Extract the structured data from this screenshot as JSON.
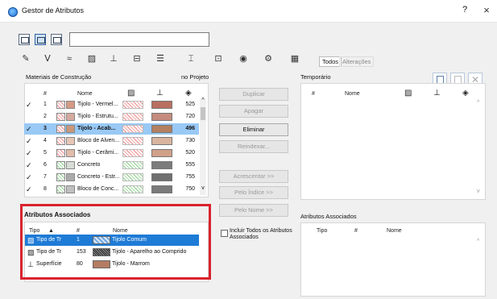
{
  "window": {
    "title": "Gestor de Atributos",
    "help": "?",
    "close": "×"
  },
  "toolbar": {
    "search_value": "",
    "attr_icons": [
      "pen-icon",
      "layer-icon",
      "line-type-icon",
      "fill-icon",
      "composite-icon",
      "profile-icon",
      "material-icon",
      "zone-icon",
      "markup-icon",
      "surface-icon",
      "mep-icon",
      "category-icon"
    ],
    "tab_all": "Todos",
    "tab_changes": "Alterações"
  },
  "left_panel": {
    "title": "Materiais de Construção",
    "project_label": "no Projeto",
    "headers": {
      "num": "#",
      "name": "Nome"
    },
    "rows": [
      {
        "check": "✓",
        "num": "1",
        "name": "Tijolo - Vermel...",
        "count": "525",
        "color": "#b97060",
        "swatch": "#d69a86",
        "hatch": "red"
      },
      {
        "check": "",
        "num": "2",
        "name": "Tijolo - Estrutu...",
        "count": "720",
        "color": "#c48b7e",
        "swatch": "#d5aaa0",
        "hatch": "red"
      },
      {
        "check": "✓",
        "num": "3",
        "name": "Tijolo - Acab...",
        "count": "496",
        "color": "#b38060",
        "swatch": "#c9987c",
        "hatch": "red",
        "selected": true
      },
      {
        "check": "✓",
        "num": "4",
        "name": "Bloco de Alven...",
        "count": "730",
        "color": "#d9b49e",
        "swatch": "#e6c7b6",
        "hatch": "red"
      },
      {
        "check": "✓",
        "num": "5",
        "name": "Tijolo - Cerâmi...",
        "count": "520",
        "color": "#d1a088",
        "swatch": "#e1bcab",
        "hatch": "red"
      },
      {
        "check": "✓",
        "num": "6",
        "name": "Concreto",
        "count": "555",
        "color": "#7c7c7c",
        "swatch": "#d8dcd6",
        "hatch": "green"
      },
      {
        "check": "✓",
        "num": "7",
        "name": "Concreto - Estr...",
        "count": "755",
        "color": "#6f6f6f",
        "swatch": "#ababab",
        "hatch": "green"
      },
      {
        "check": "✓",
        "num": "8",
        "name": "Bloco de Conc...",
        "count": "750",
        "color": "#7a7a7a",
        "swatch": "#c0c0c0",
        "hatch": "green"
      }
    ]
  },
  "buttons": {
    "duplicate": "Duplicar",
    "delete_soft": "Apagar",
    "delete": "Eliminar",
    "reindex": "Reindexar...",
    "append": "Acrescentar >>",
    "by_index": "Pelo Índice >>",
    "by_name": "Pelo Nome >>"
  },
  "assoc": {
    "title": "Atributos Associados",
    "headers": {
      "type": "Tipo",
      "num": "#",
      "name": "Nome"
    },
    "rows": [
      {
        "type": "Tipo de Tr",
        "num": "1",
        "name": "Tijolo Comum",
        "selected": true
      },
      {
        "type": "Tipo de Tr",
        "num": "153",
        "name": "Tijolo - Aparelho ao Comprido"
      },
      {
        "type": "Superfície",
        "num": "80",
        "name": "Tijolo - Marrom"
      }
    ],
    "include_label": "Incluir Todos os Atributos Associados",
    "include_checked": false
  },
  "right_panel": {
    "title": "Temporário",
    "headers": {
      "num": "#",
      "name": "Nome"
    },
    "assoc_title": "Atributos Associados",
    "assoc_headers": {
      "type": "Tipo",
      "num": "#",
      "name": "Nome"
    }
  }
}
